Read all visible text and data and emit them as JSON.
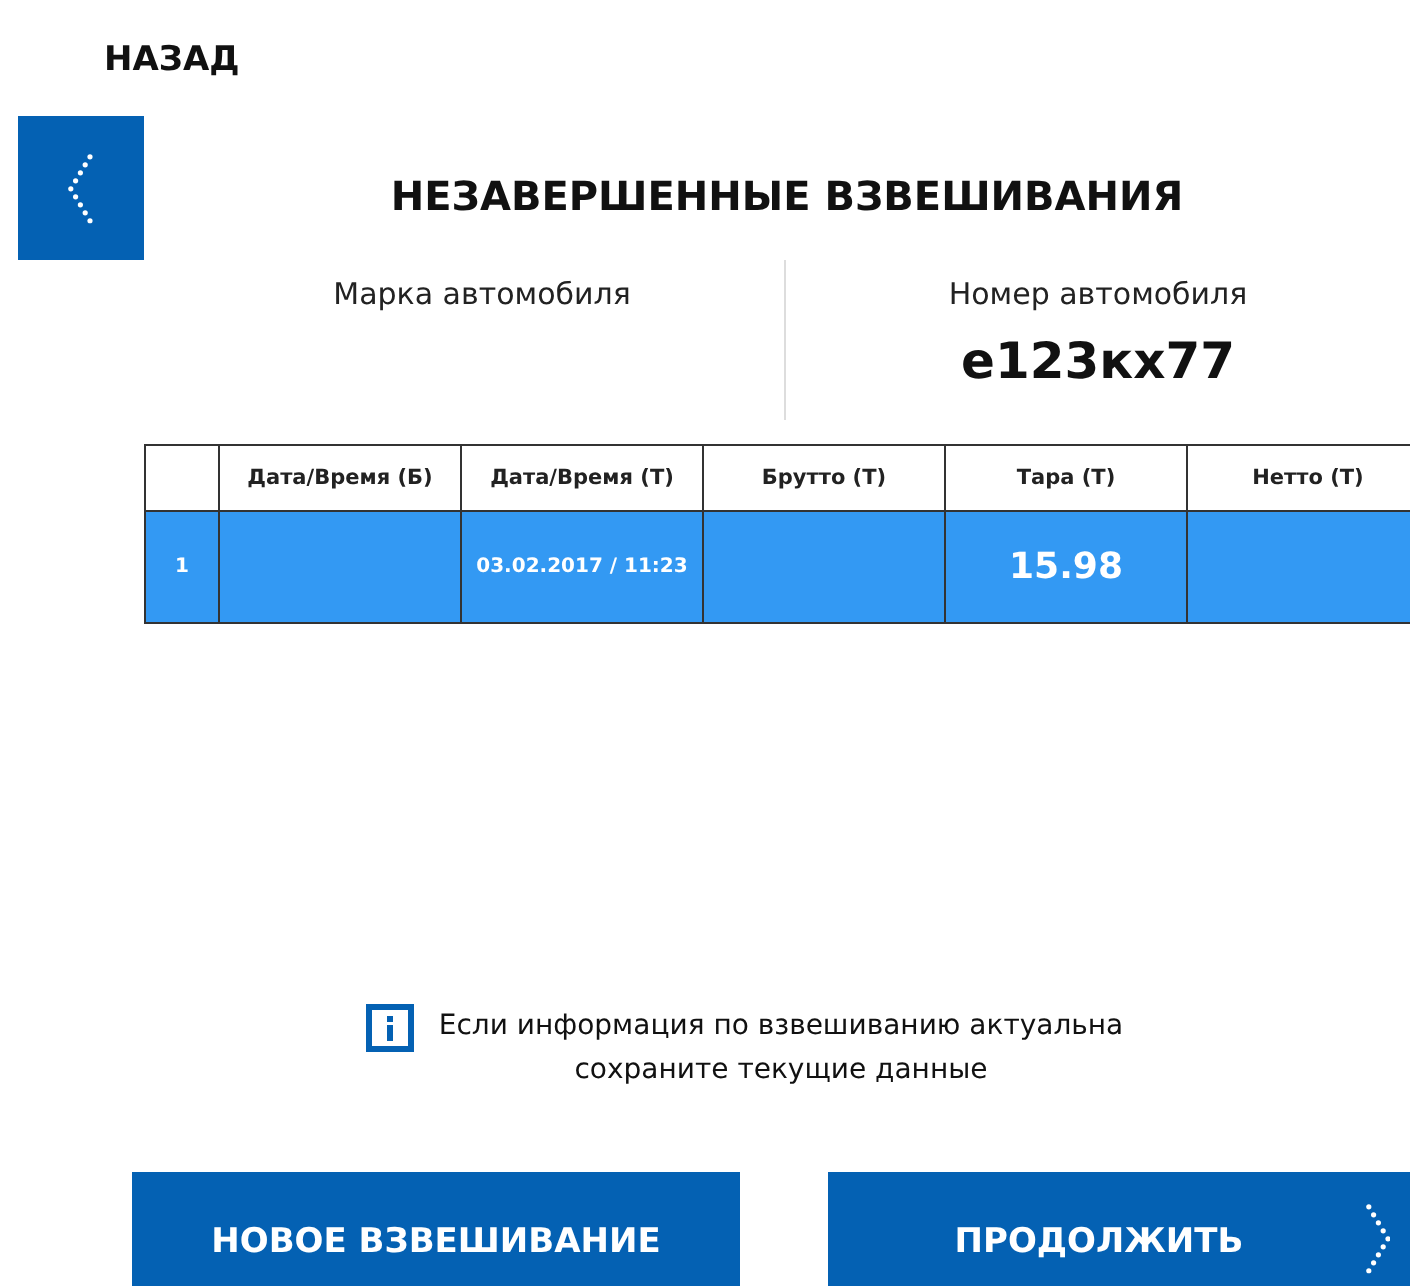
{
  "back_label": "НАЗАД",
  "title": "НЕЗАВЕРШЕННЫЕ ВЗВЕШИВАНИЯ",
  "vehicle": {
    "make_label": "Марка автомобиля",
    "number_label": "Номер автомобиля",
    "number": "е123кх77"
  },
  "table": {
    "columns": [
      "",
      "Дата/Время (Б)",
      "Дата/Время (Т)",
      "Брутто (Т)",
      "Тара (Т)",
      "Нетто (Т)"
    ],
    "rows": [
      {
        "selected": true,
        "cells": [
          "1",
          "",
          "03.02.2017 / 11:23",
          "",
          "15.98",
          ""
        ]
      }
    ]
  },
  "info": [
    "Если информация по взвешиванию актуальна",
    "сохраните текущие данные"
  ],
  "buttons": [
    "НОВОЕ ВЗВЕШИВАНИЕ",
    "ПРОДОЛЖИТЬ"
  ]
}
